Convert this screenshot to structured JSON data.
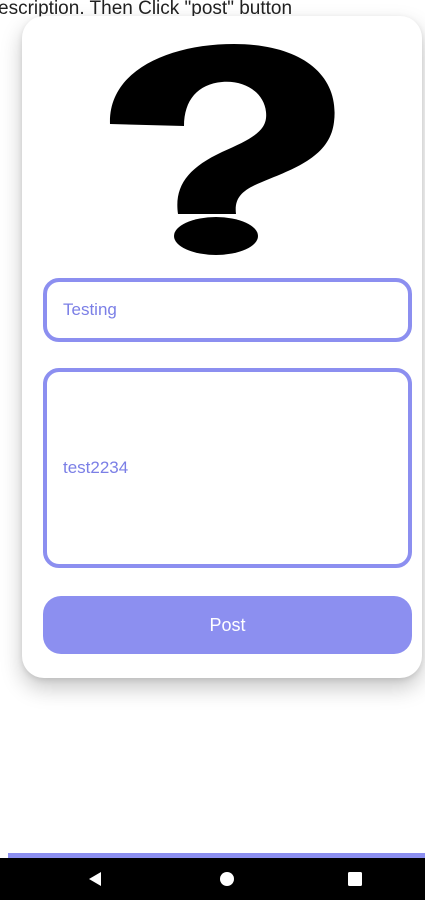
{
  "instruction": {
    "text": "escription. Then Click \"post\" button"
  },
  "form": {
    "title_value": "Testing",
    "description_value": "test2234",
    "post_label": "Post"
  },
  "icons": {
    "main": "question-mark-icon",
    "nav_back": "back-triangle-icon",
    "nav_home": "home-circle-icon",
    "nav_recents": "recents-square-icon"
  },
  "colors": {
    "accent": "#8c8ff0",
    "field_text": "#7b7fe6",
    "nav_bar": "#000000"
  }
}
